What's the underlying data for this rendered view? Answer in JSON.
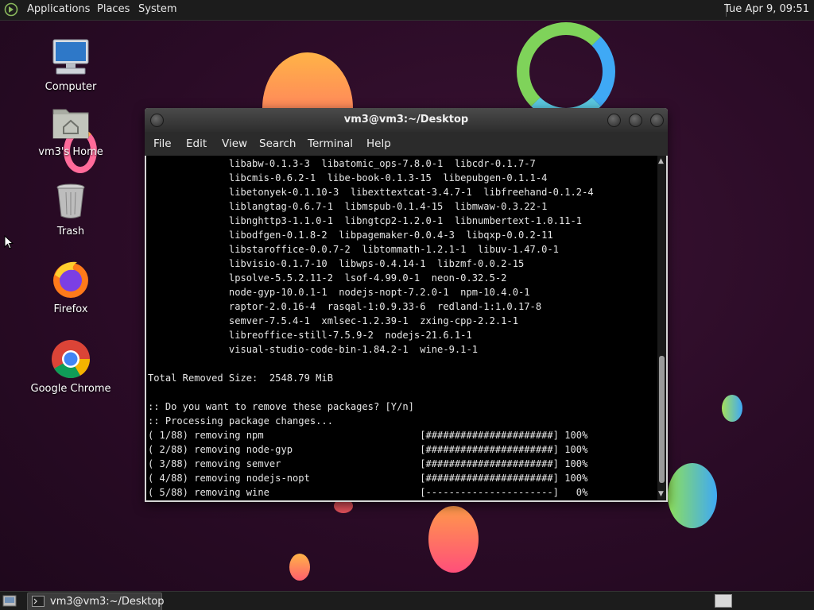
{
  "top_panel": {
    "menus": [
      "Applications",
      "Places",
      "System"
    ],
    "clock": "Tue Apr  9, 09:51"
  },
  "desktop_icons": [
    {
      "label": "Computer",
      "icon": "computer-icon"
    },
    {
      "label": "vm3's Home",
      "icon": "home-folder-icon"
    },
    {
      "label": "Trash",
      "icon": "trash-icon"
    },
    {
      "label": "Firefox",
      "icon": "firefox-icon"
    },
    {
      "label": "Google Chrome",
      "icon": "chrome-icon"
    }
  ],
  "terminal": {
    "title": "vm3@vm3:~/Desktop",
    "menu": [
      "File",
      "Edit",
      "View",
      "Search",
      "Terminal",
      "Help"
    ],
    "lines": [
      "              libabw-0.1.3-3  libatomic_ops-7.8.0-1  libcdr-0.1.7-7",
      "              libcmis-0.6.2-1  libe-book-0.1.3-15  libepubgen-0.1.1-4",
      "              libetonyek-0.1.10-3  libexttextcat-3.4.7-1  libfreehand-0.1.2-4",
      "              liblangtag-0.6.7-1  libmspub-0.1.4-15  libmwaw-0.3.22-1",
      "              libnghttp3-1.1.0-1  libngtcp2-1.2.0-1  libnumbertext-1.0.11-1",
      "              libodfgen-0.1.8-2  libpagemaker-0.0.4-3  libqxp-0.0.2-11",
      "              libstaroffice-0.0.7-2  libtommath-1.2.1-1  libuv-1.47.0-1",
      "              libvisio-0.1.7-10  libwps-0.4.14-1  libzmf-0.0.2-15",
      "              lpsolve-5.5.2.11-2  lsof-4.99.0-1  neon-0.32.5-2",
      "              node-gyp-10.0.1-1  nodejs-nopt-7.2.0-1  npm-10.4.0-1",
      "              raptor-2.0.16-4  rasqal-1:0.9.33-6  redland-1:1.0.17-8",
      "              semver-7.5.4-1  xmlsec-1.2.39-1  zxing-cpp-2.2.1-1",
      "              libreoffice-still-7.5.9-2  nodejs-21.6.1-1",
      "              visual-studio-code-bin-1.84.2-1  wine-9.1-1",
      "",
      "Total Removed Size:  2548.79 MiB",
      "",
      ":: Do you want to remove these packages? [Y/n]",
      ":: Processing package changes...",
      "( 1/88) removing npm                           [######################] 100%",
      "( 2/88) removing node-gyp                      [######################] 100%",
      "( 3/88) removing semver                        [######################] 100%",
      "( 4/88) removing nodejs-nopt                   [######################] 100%",
      "( 5/88) removing wine                          [----------------------]   0%"
    ]
  },
  "taskbar": {
    "window_label": "vm3@vm3:~/Desktop"
  },
  "colors": {
    "desktop_bg": "#2a0b26",
    "panel_bg": "#1c1c1c",
    "terminal_bg": "#000000",
    "terminal_fg": "#e6e6e6"
  }
}
